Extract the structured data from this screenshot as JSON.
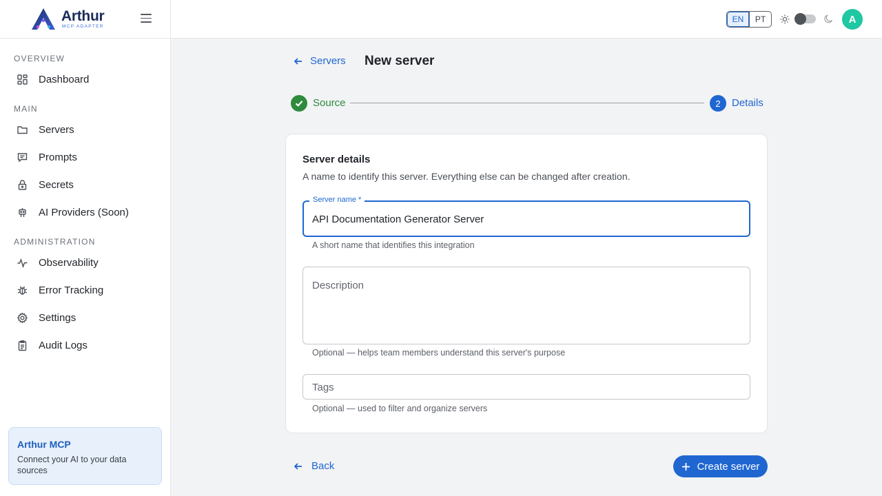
{
  "brand": {
    "name": "Arthur",
    "subtitle": "MCP ADAPTER"
  },
  "sidebar": {
    "sections": [
      {
        "title": "OVERVIEW",
        "items": [
          {
            "label": "Dashboard",
            "icon": "dashboard-icon"
          }
        ]
      },
      {
        "title": "MAIN",
        "items": [
          {
            "label": "Servers",
            "icon": "folder-icon"
          },
          {
            "label": "Prompts",
            "icon": "message-icon"
          },
          {
            "label": "Secrets",
            "icon": "lock-icon"
          },
          {
            "label": "AI Providers (Soon)",
            "icon": "robot-icon"
          }
        ]
      },
      {
        "title": "ADMINISTRATION",
        "items": [
          {
            "label": "Observability",
            "icon": "activity-icon"
          },
          {
            "label": "Error Tracking",
            "icon": "bug-icon"
          },
          {
            "label": "Settings",
            "icon": "gear-icon"
          },
          {
            "label": "Audit Logs",
            "icon": "clipboard-icon"
          }
        ]
      }
    ],
    "promo": {
      "title": "Arthur MCP",
      "text": "Connect your AI to your data sources"
    }
  },
  "topbar": {
    "languages": [
      "EN",
      "PT"
    ],
    "active_language": "EN",
    "theme_toggle": "light",
    "avatar_initial": "A"
  },
  "header": {
    "back_label": "Servers",
    "title": "New server"
  },
  "stepper": {
    "steps": [
      {
        "label": "Source",
        "status": "done"
      },
      {
        "number": "2",
        "label": "Details",
        "status": "current"
      }
    ]
  },
  "form": {
    "title": "Server details",
    "description": "A name to identify this server. Everything else can be changed after creation.",
    "name_field": {
      "label": "Server name *",
      "value": "API Documentation Generator Server",
      "help": "A short name that identifies this integration"
    },
    "description_field": {
      "placeholder": "Description",
      "help": "Optional — helps team members understand this server's purpose"
    },
    "tags_field": {
      "placeholder": "Tags",
      "help": "Optional — used to filter and organize servers"
    }
  },
  "footer": {
    "back_label": "Back",
    "create_label": "Create server"
  },
  "colors": {
    "accent": "#1f66d1",
    "success": "#2e8b3d",
    "avatar": "#1fc7a2",
    "brand_dark": "#1a2b5a"
  }
}
